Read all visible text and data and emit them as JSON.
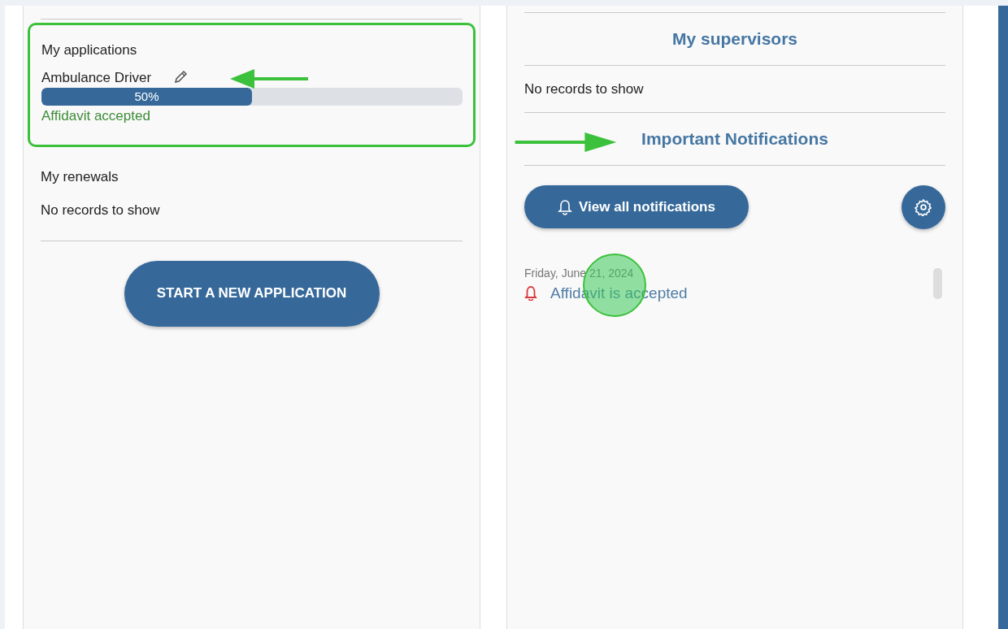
{
  "applications": {
    "title": "My applications",
    "items": [
      {
        "name": "Ambulance Driver",
        "level": 0.5,
        "percent": "50%",
        "status": "Affidavit accepted"
      }
    ]
  },
  "renewals": {
    "title": "My renewals",
    "empty_text": "No records to show"
  },
  "start_button": "START A NEW APPLICATION",
  "supervisors": {
    "title": "My supervisors",
    "empty_text": "No records to show"
  },
  "notifications": {
    "title": "Important Notifications",
    "view_all_button": "View all notifications",
    "items": [
      {
        "date": "Friday, June 21, 2024",
        "text": "Affidavit is accepted"
      }
    ]
  }
}
